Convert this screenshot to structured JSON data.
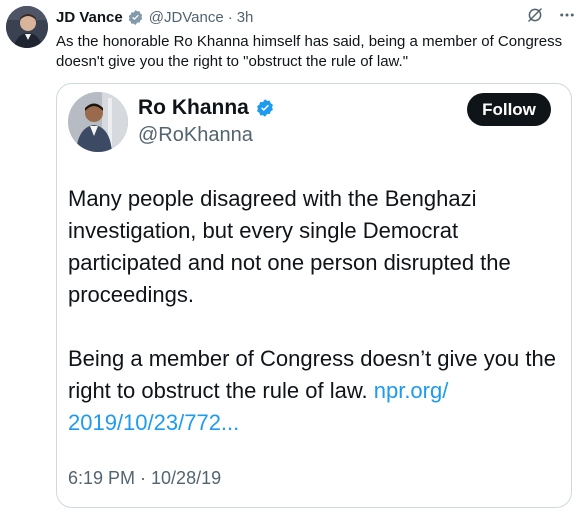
{
  "tweet": {
    "author_name": "JD Vance",
    "handle": "@JDVance",
    "separator": "·",
    "time": "3h",
    "text": "As the honorable Ro Khanna himself has said, being a member of Congress doesn't give you the right to \"obstruct the rule of law.\"",
    "icons": [
      "verified-badge-icon",
      "grok-icon",
      "more-icon"
    ]
  },
  "quoted_tweet": {
    "author_name": "Ro Khanna",
    "handle": "@RoKhanna",
    "follow_label": "Follow",
    "paragraph1": "Many people disagreed with the Benghazi investigation, but every single Democrat participated and not one person disrupted the proceedings.",
    "paragraph2": "Being a member of Congress doesn’t give you the right to obstruct the rule of law.",
    "link_text": "npr.org/ 2019/10/23/772...",
    "timestamp": "6:19 PM · 10/28/19"
  },
  "colors": {
    "text_primary": "#0f1419",
    "text_secondary": "#536471",
    "link": "#1d9bf0",
    "verified": "#1d9bf0",
    "follow_bg": "#0f1419",
    "border": "#cfd9de"
  }
}
